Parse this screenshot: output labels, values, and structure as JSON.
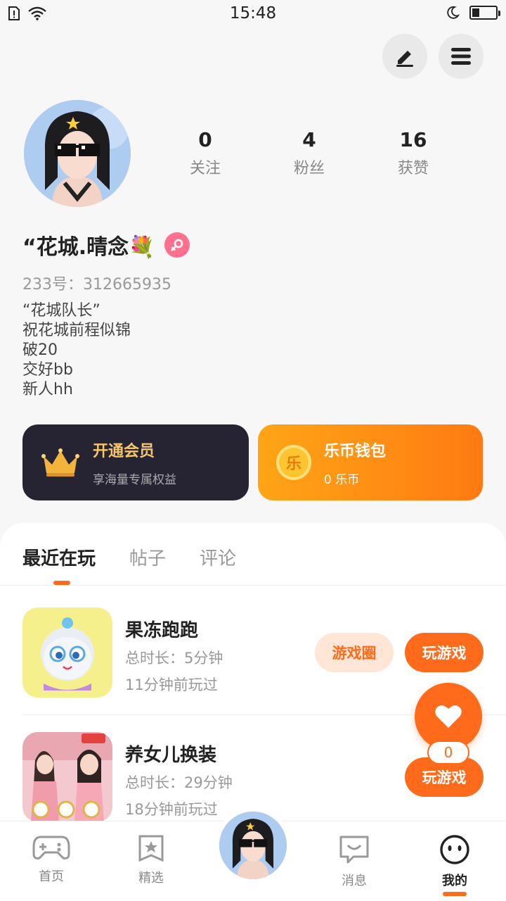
{
  "status_bar": {
    "time": "15:48",
    "battery_level": 0.3
  },
  "header": {
    "edit_icon": "pen-icon",
    "menu_icon": "menu-icon"
  },
  "profile": {
    "stats": [
      {
        "value": "0",
        "label": "关注"
      },
      {
        "value": "4",
        "label": "粉丝"
      },
      {
        "value": "16",
        "label": "获赞"
      }
    ],
    "nickname": "“花城.晴念💐",
    "uid": "233号：312665935",
    "bio": [
      "“花城队长”",
      "祝花城前程似锦",
      "破20",
      "交好bb",
      "新人hh"
    ]
  },
  "cards": {
    "vip": {
      "title": "开通会员",
      "subtitle": "享海量专属权益"
    },
    "wallet": {
      "title": "乐币钱包",
      "subtitle": "0 乐币",
      "coin_glyph": "乐"
    }
  },
  "tabs": [
    "最近在玩",
    "帖子",
    "评论"
  ],
  "games": [
    {
      "name": "果冻跑跑",
      "duration": "总时长：5分钟",
      "last_played": "11分钟前玩过",
      "circle_label": "游戏圈",
      "play_label": "玩游戏"
    },
    {
      "name": "养女儿换装",
      "duration": "总时长：29分钟",
      "last_played": "18分钟前玩过",
      "play_label": "玩游戏"
    }
  ],
  "fab": {
    "count": "0"
  },
  "bottom_nav": [
    {
      "label": "首页",
      "icon": "gamepad-icon"
    },
    {
      "label": "精选",
      "icon": "star-bookmark-icon"
    },
    {
      "label": "消息",
      "icon": "chat-icon"
    },
    {
      "label": "我的",
      "icon": "smile-face-icon"
    }
  ],
  "colors": {
    "accent": "#ff6b1a",
    "vip_bg": "#262433",
    "vip_text": "#f5c66b"
  }
}
